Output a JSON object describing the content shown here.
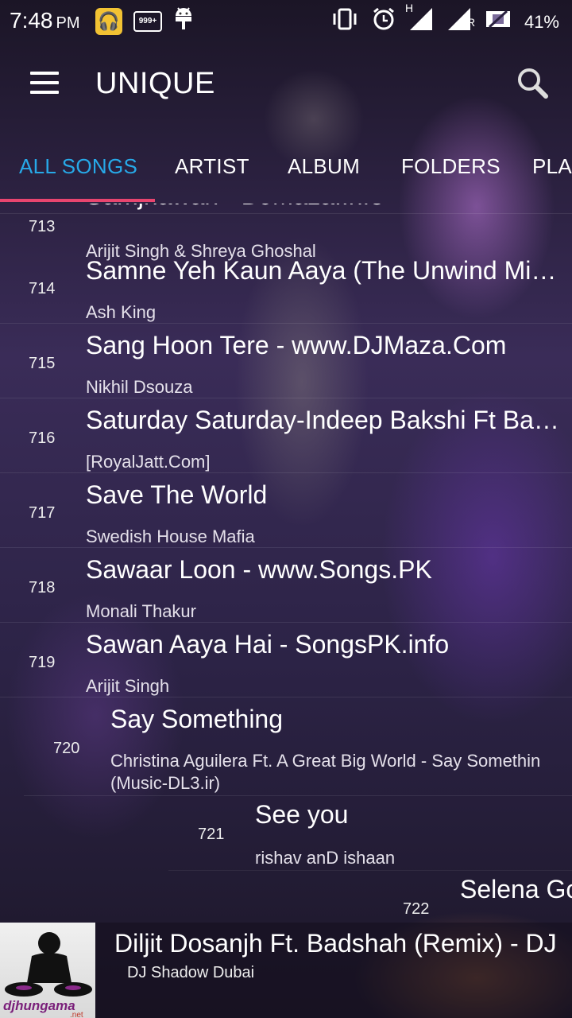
{
  "status_bar": {
    "time": "7:48",
    "ampm": "PM",
    "notif_badge": "999+",
    "signal_h": "H",
    "signal_r": "R",
    "battery": "41%"
  },
  "app": {
    "title": "UNIQUE"
  },
  "tabs": [
    {
      "label": "ALL SONGS",
      "active": true
    },
    {
      "label": "ARTIST"
    },
    {
      "label": "ALBUM"
    },
    {
      "label": "FOLDERS"
    },
    {
      "label": "PLA"
    }
  ],
  "songs": [
    {
      "num": "713",
      "title": "Samjhawan - DJMaza.Info",
      "artist": "Arijit Singh & Shreya Ghoshal"
    },
    {
      "num": "714",
      "title": "Samne Yeh Kaun Aaya (The Unwind Mi…",
      "artist": "Ash King"
    },
    {
      "num": "715",
      "title": "Sang Hoon Tere - www.DJMaza.Com",
      "artist": "Nikhil Dsouza"
    },
    {
      "num": "716",
      "title": "Saturday Saturday-Indeep Bakshi Ft Ba…",
      "artist": "[RoyalJatt.Com]"
    },
    {
      "num": "717",
      "title": "Save The World",
      "artist": "Swedish House Mafia"
    },
    {
      "num": "718",
      "title": "Sawaar Loon - www.Songs.PK",
      "artist": "Monali Thakur"
    },
    {
      "num": "719",
      "title": "Sawan Aaya Hai - SongsPK.info",
      "artist": "Arijit Singh"
    },
    {
      "num": "720",
      "title": "Say Something",
      "artist": "Christina Aguilera Ft. A Great Big World - Say Somethin",
      "artist2": "(Music-DL3.ir)"
    },
    {
      "num": "721",
      "title": "See you",
      "artist": "rishav anD ishaan"
    },
    {
      "num": "722",
      "title": "Selena Go"
    }
  ],
  "now_playing": {
    "title": "Diljit Dosanjh Ft. Badshah (Remix) - DJ",
    "artist": "DJ Shadow Dubai",
    "art_text": "djhungama",
    "art_subtext": ".net"
  },
  "colors": {
    "active_tab": "#27a9e8",
    "indicator": "#e8456f"
  }
}
